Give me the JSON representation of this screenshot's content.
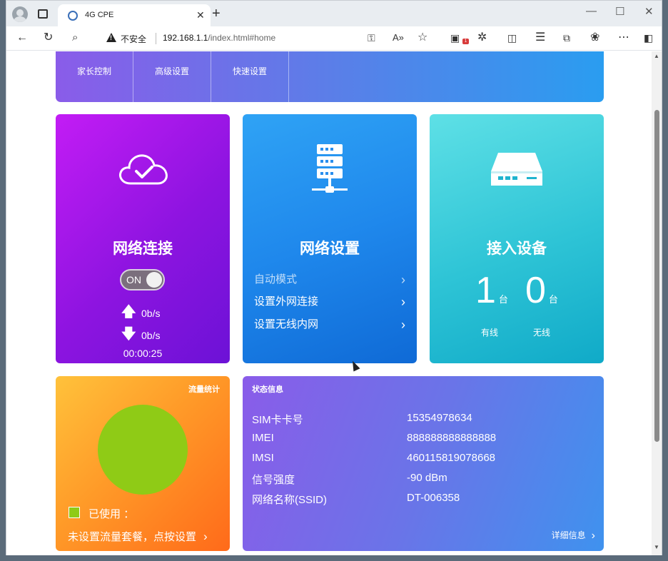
{
  "browser": {
    "tab_title": "4G CPE",
    "insecure_label": "不安全",
    "url_host": "192.168.1.1",
    "url_path": "/index.html#home",
    "notification_count": "1"
  },
  "nav": {
    "items": [
      {
        "label": "家长控制"
      },
      {
        "label": "高级设置"
      },
      {
        "label": "快速设置"
      }
    ]
  },
  "network_connection": {
    "title": "网络连接",
    "toggle_label": "ON",
    "toggle_on": true,
    "upload_rate": "0b/s",
    "download_rate": "0b/s",
    "uptime": "00:00:25"
  },
  "network_settings": {
    "title": "网络设置",
    "items": [
      {
        "label": "自动模式"
      },
      {
        "label": "设置外网连接"
      },
      {
        "label": "设置无线内网"
      }
    ]
  },
  "devices": {
    "title": "接入设备",
    "wired_count": "1",
    "wireless_count": "0",
    "unit": "台",
    "wired_label": "有线",
    "wireless_label": "无线"
  },
  "traffic": {
    "title": "流量统计",
    "used_label": "已使用 ：",
    "used_color": "#8fcb16",
    "plan_link": "未设置流量套餐，点按设置"
  },
  "status": {
    "title": "状态信息",
    "rows": [
      {
        "key": "SIM卡卡号",
        "value": "15354978634"
      },
      {
        "key": "IMEI",
        "value": "888888888888888"
      },
      {
        "key": "IMSI",
        "value": "460115819078668"
      },
      {
        "key": "信号强度",
        "value": "-90 dBm"
      },
      {
        "key": "网络名称(SSID)",
        "value": "DT-006358"
      }
    ],
    "detail_link": "详细信息"
  }
}
